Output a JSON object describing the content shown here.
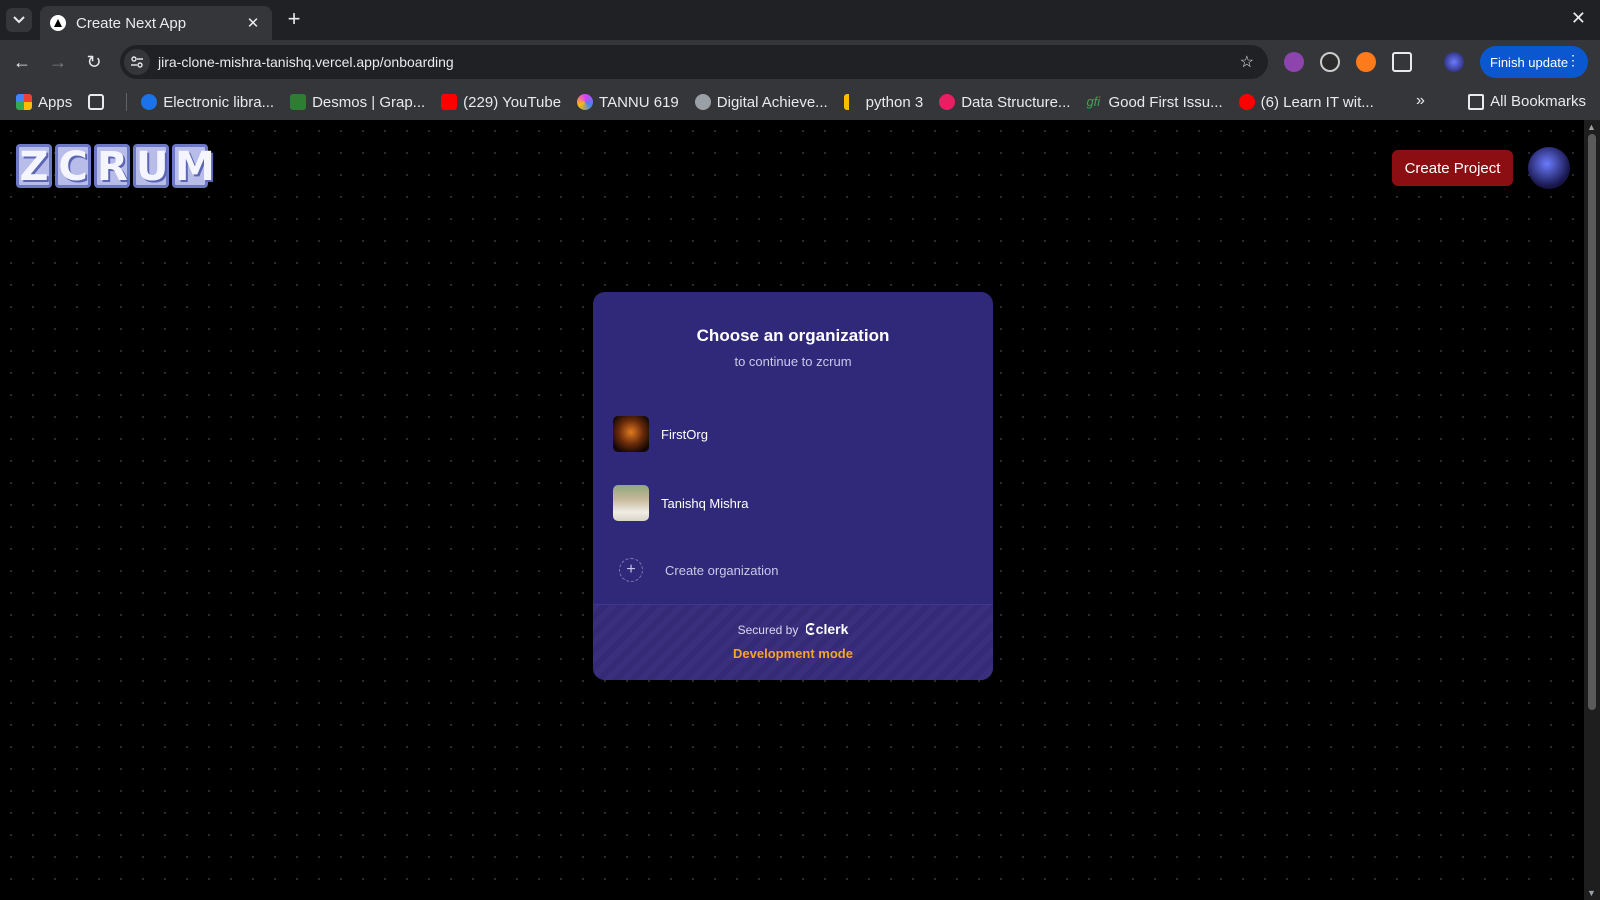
{
  "browser": {
    "tab": {
      "title": "Create Next App"
    },
    "url": "jira-clone-mishra-tanishq.vercel.app/onboarding",
    "finish_update": "Finish update",
    "bookmarks": [
      {
        "label": "Apps",
        "color": "#4285f4"
      },
      {
        "label": "Electronic libra...",
        "color": "#1a73e8"
      },
      {
        "label": "Desmos | Grap...",
        "color": "#2e7d32"
      },
      {
        "label": "(229) YouTube",
        "color": "#ff0000"
      },
      {
        "label": "TANNU 619",
        "color": "#e040fb"
      },
      {
        "label": "Digital Achieve...",
        "color": "#9aa0a6"
      },
      {
        "label": "python 3",
        "color": "#fbbc04"
      },
      {
        "label": "Data Structure...",
        "color": "#e91e63"
      },
      {
        "label": "Good First Issu...",
        "color": "#34a853"
      },
      {
        "label": "(6) Learn IT wit...",
        "color": "#ff0000"
      }
    ],
    "all_bookmarks": "All Bookmarks"
  },
  "app": {
    "logo_letters": [
      "Z",
      "C",
      "R",
      "U",
      "M"
    ],
    "create_project": "Create Project"
  },
  "org_switcher": {
    "title": "Choose an organization",
    "subtitle": "to continue to zcrum",
    "organizations": [
      {
        "name": "FirstOrg"
      },
      {
        "name": "Tanishq Mishra"
      }
    ],
    "create_org": "Create organization",
    "secured_by": "Secured by",
    "brand": "clerk",
    "dev_mode": "Development mode"
  }
}
